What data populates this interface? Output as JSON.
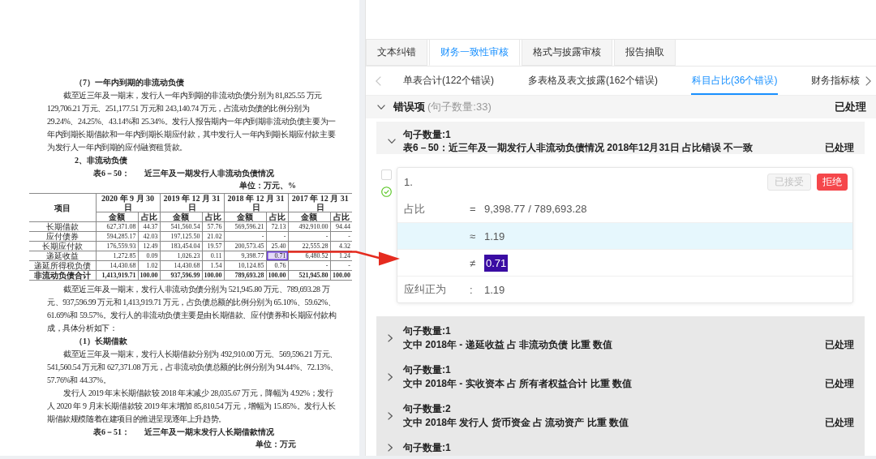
{
  "document": {
    "blocks": [
      {
        "kind": "heading",
        "text": "（7）一年内到期的非流动负债"
      },
      {
        "kind": "paragraph",
        "text": "截至近三年及一期末，发行人一年内到期的非流动负债分别为 81,825.55 万元 129,706.21 万元、251,177.51 万元和 243,140.74 万元，占流动负债的比例分别为 29.24%、24.25%、43.14%和 25.34%。发行人报告期内一年内到期非流动负债主要为一年内到期长期借款和一年内到期长期应付款，其中发行人一年内到期长期应付款主要为发行人一年内到期的应付融资租赁款。"
      },
      {
        "kind": "heading",
        "text": "2、非流动负债"
      },
      {
        "kind": "caption",
        "number": "表6－50：",
        "title": "近三年及一期发行人非流动负债情况"
      },
      {
        "kind": "unit",
        "text": "单位：万元、%"
      },
      {
        "kind": "table",
        "corner": "项目",
        "periods": [
          "2020 年 9 月 30 日",
          "2019 年 12 月 31 日",
          "2018 年 12 月 31 日",
          "2017 年 12 月 31 日"
        ],
        "subheaders": [
          "金额",
          "占比",
          "金额",
          "占比",
          "金额",
          "占比",
          "金额",
          "占比"
        ],
        "rows": [
          {
            "kind": "item",
            "name": "长期借款",
            "cells": [
              {
                "text": "627,371.08",
                "flagged": false
              },
              {
                "text": "44.37",
                "flagged": false
              },
              {
                "text": "541,560.54",
                "flagged": false
              },
              {
                "text": "57.76",
                "flagged": false
              },
              {
                "text": "569,596.21",
                "flagged": false
              },
              {
                "text": "72.13",
                "flagged": false
              },
              {
                "text": "492,910.00",
                "flagged": false
              },
              {
                "text": "94.44",
                "flagged": false
              }
            ]
          },
          {
            "kind": "item",
            "name": "应付债券",
            "cells": [
              {
                "text": "594,285.17",
                "flagged": false
              },
              {
                "text": "42.03",
                "flagged": false
              },
              {
                "text": "197,125.50",
                "flagged": false
              },
              {
                "text": "21.02",
                "flagged": false
              },
              {
                "text": "-",
                "flagged": false
              },
              {
                "text": "-",
                "flagged": false
              },
              {
                "text": "-",
                "flagged": false
              },
              {
                "text": "-",
                "flagged": false
              }
            ]
          },
          {
            "kind": "item",
            "name": "长期应付款",
            "cells": [
              {
                "text": "176,559.93",
                "flagged": false
              },
              {
                "text": "12.49",
                "flagged": false
              },
              {
                "text": "183,454.04",
                "flagged": false
              },
              {
                "text": "19.57",
                "flagged": false
              },
              {
                "text": "200,573.45",
                "flagged": false
              },
              {
                "text": "25.40",
                "flagged": false
              },
              {
                "text": "22,555.28",
                "flagged": false
              },
              {
                "text": "4.32",
                "flagged": false
              }
            ]
          },
          {
            "kind": "item",
            "name": "递延收益",
            "cells": [
              {
                "text": "1,272.85",
                "flagged": false
              },
              {
                "text": "0.09",
                "flagged": false
              },
              {
                "text": "1,026.23",
                "flagged": false
              },
              {
                "text": "0.11",
                "flagged": false
              },
              {
                "text": "9,398.77",
                "flagged": false
              },
              {
                "text": "0.71",
                "flagged": true
              },
              {
                "text": "6,480.52",
                "flagged": false
              },
              {
                "text": "1.24",
                "flagged": false
              }
            ]
          },
          {
            "kind": "item",
            "name": "递延所得税负债",
            "cells": [
              {
                "text": "14,430.68",
                "flagged": false
              },
              {
                "text": "1.02",
                "flagged": false
              },
              {
                "text": "14,430.68",
                "flagged": false
              },
              {
                "text": "1.54",
                "flagged": false
              },
              {
                "text": "10,124.85",
                "flagged": false
              },
              {
                "text": "0.76",
                "flagged": false
              },
              {
                "text": "-",
                "flagged": false
              },
              {
                "text": "-",
                "flagged": false
              }
            ]
          },
          {
            "kind": "total",
            "name": "非流动负债合计",
            "cells": [
              {
                "text": "1,413,919.71",
                "flagged": false
              },
              {
                "text": "100.00",
                "flagged": false
              },
              {
                "text": "937,596.99",
                "flagged": false
              },
              {
                "text": "100.00",
                "flagged": false
              },
              {
                "text": "789,693.28",
                "flagged": false
              },
              {
                "text": "100.00",
                "flagged": false
              },
              {
                "text": "521,945.80",
                "flagged": false
              },
              {
                "text": "100.00",
                "flagged": false
              }
            ]
          }
        ]
      },
      {
        "kind": "paragraph",
        "text": "截至近三年及一期末，发行人非流动负债分别为 521,945.80 万元、789,693.28 万元、937,596.99 万元和 1,413,919.71 万元，占负债总额的比例分别为 65.10%、59.62%、61.69%和 59.57%。发行人的非流动负债主要是由长期借款、应付债券和长期应付款构成，具体分析如下："
      },
      {
        "kind": "heading",
        "text": "（1）长期借款"
      },
      {
        "kind": "paragraph",
        "text": "截至近三年及一期末，发行人长期借款分别为 492,910.00 万元、569,596.21 万元、541,560.54 万元和 627,371.08 万元，占非流动负债总额的比例分别为 94.44%、72.13%、57.76%和 44.37%。"
      },
      {
        "kind": "paragraph",
        "text": "发行人 2019 年末长期借款较 2018 年末减少 28,035.67 万元，降幅为 4.92%；发行人 2020 年 9 月末长期借款较 2019 年末增加 85,810.54 万元，增幅为 15.85%。发行人长期借款规模随着在建项目的推进呈现逐年上升趋势。"
      },
      {
        "kind": "caption",
        "number": "表6－51：",
        "title": "近三年及一期末发行人长期借款情况"
      },
      {
        "kind": "unit",
        "text": "单位：万元"
      }
    ]
  },
  "review": {
    "tabs": [
      {
        "label": "文本纠错",
        "selected": false
      },
      {
        "label": "财务一致性审核",
        "selected": true
      },
      {
        "label": "格式与披露审核",
        "selected": false
      },
      {
        "label": "报告抽取",
        "selected": false
      }
    ],
    "subtabs": [
      {
        "label": "单表合计(122个错误)",
        "selected": false
      },
      {
        "label": "多表格及表文披露(162个错误)",
        "selected": false
      },
      {
        "label": "科目占比(36个错误)",
        "selected": true
      },
      {
        "label": "财务指标核",
        "selected": false
      }
    ],
    "section": {
      "title": "错误项",
      "count": "(句子数量:33)",
      "status": "已处理",
      "expanded": true,
      "groups": [
        {
          "expanded": true,
          "count": "句子数量:1",
          "description": "表6－50：近三年及一期发行人非流动负债情况 2018年12月31日 占比错误 不一致",
          "status": "已处理",
          "entries": [
            {
              "number": "1.",
              "checked": false,
              "resolved": true,
              "buttons": [
                {
                  "kind": "accept",
                  "label": "已接受",
                  "disabled": true
                },
                {
                  "kind": "reject",
                  "label": "拒绝",
                  "disabled": false
                }
              ],
              "rows": [
                {
                  "label": "占比",
                  "operator": "=",
                  "value": "9,398.77 / 789,693.28",
                  "highlighted": false,
                  "error": false
                },
                {
                  "operator": "≈",
                  "value": "1.19",
                  "highlighted": true,
                  "error": false
                },
                {
                  "operator": "≠",
                  "value": "0.71",
                  "highlighted": false,
                  "error": true
                },
                {
                  "label": "应纠正为",
                  "operator": ":",
                  "value": "1.19",
                  "highlighted": false,
                  "error": false
                }
              ]
            }
          ]
        },
        {
          "expanded": false,
          "count": "句子数量:1",
          "description": "文中 2018年 - 递延收益 占 非流动负债 比重 数值",
          "status": "已处理"
        },
        {
          "expanded": false,
          "count": "句子数量:1",
          "description": "文中 2018年 - 实收资本 占 所有者权益合计 比重 数值",
          "status": "已处理"
        },
        {
          "expanded": false,
          "count": "句子数量:2",
          "description": "文中 2018年 发行人 货币资金 占 流动资产 比重 数值",
          "status": "已处理"
        },
        {
          "expanded": false,
          "count": "句子数量:1"
        }
      ]
    }
  }
}
